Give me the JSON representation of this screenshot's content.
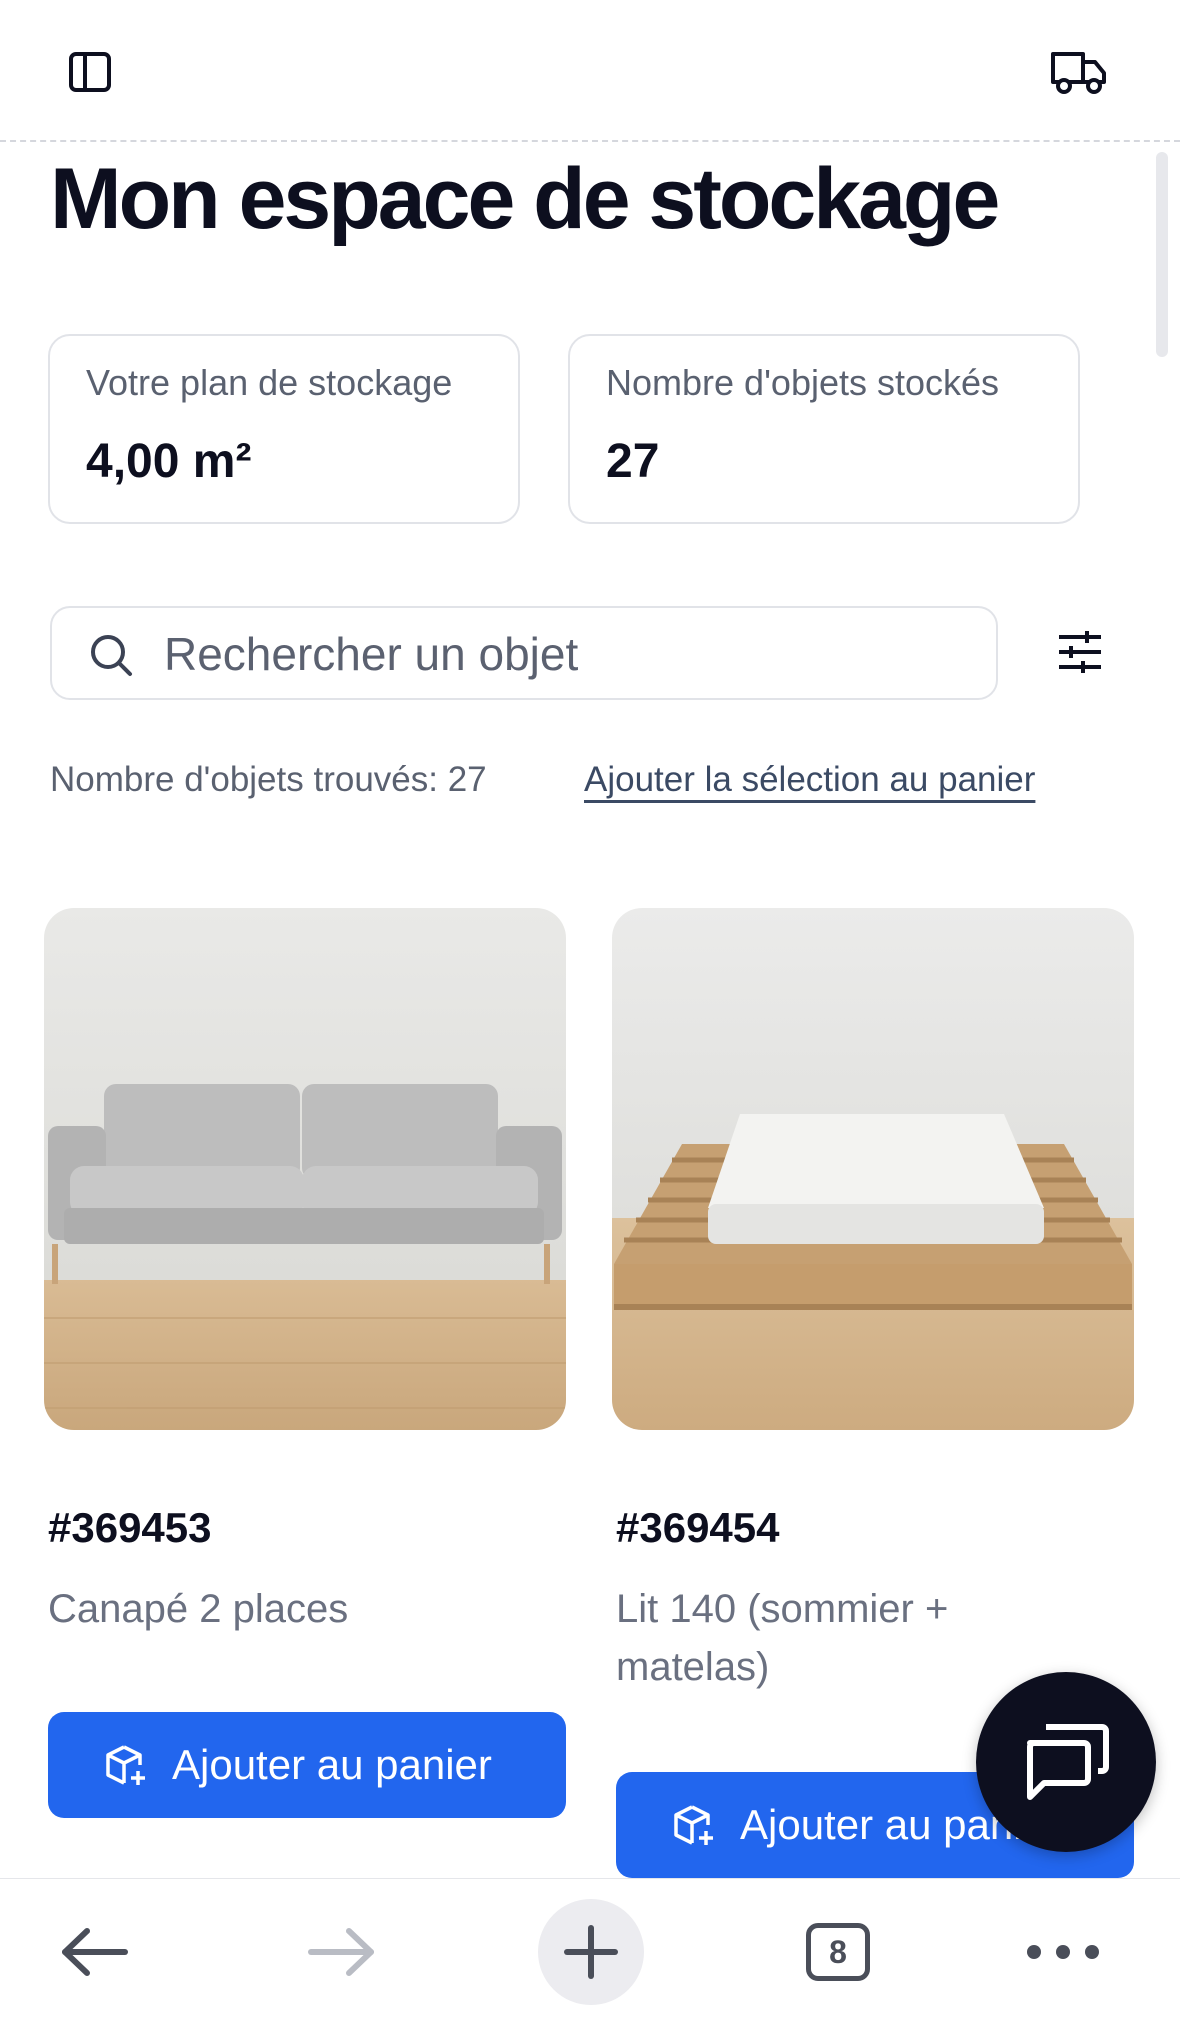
{
  "header": {
    "sidebar_icon": "sidebar-toggle-icon",
    "delivery_icon": "truck-icon"
  },
  "page": {
    "title": "Mon espace de stockage"
  },
  "stats": [
    {
      "label": "Votre plan de stockage",
      "value": "4,00 m²"
    },
    {
      "label": "Nombre d'objets stockés",
      "value": "27"
    }
  ],
  "search": {
    "placeholder": "Rechercher un objet",
    "value": "",
    "filter_icon": "sliders-icon"
  },
  "results": {
    "found_text": "Nombre d'objets trouvés: 27",
    "add_selection": "Ajouter la sélection au panier"
  },
  "products": [
    {
      "sku": "#369453",
      "name": "Canapé 2 places",
      "button": "Ajouter au panier"
    },
    {
      "sku": "#369454",
      "name": "Lit 140 (sommier + matelas)",
      "button": "Ajouter au panier"
    }
  ],
  "chat": {
    "icon": "chat-bubbles-icon"
  },
  "browser_nav": {
    "tab_count": "8"
  },
  "colors": {
    "primary": "#2266ee",
    "dark": "#0d0f1f",
    "muted": "#5a6170"
  }
}
